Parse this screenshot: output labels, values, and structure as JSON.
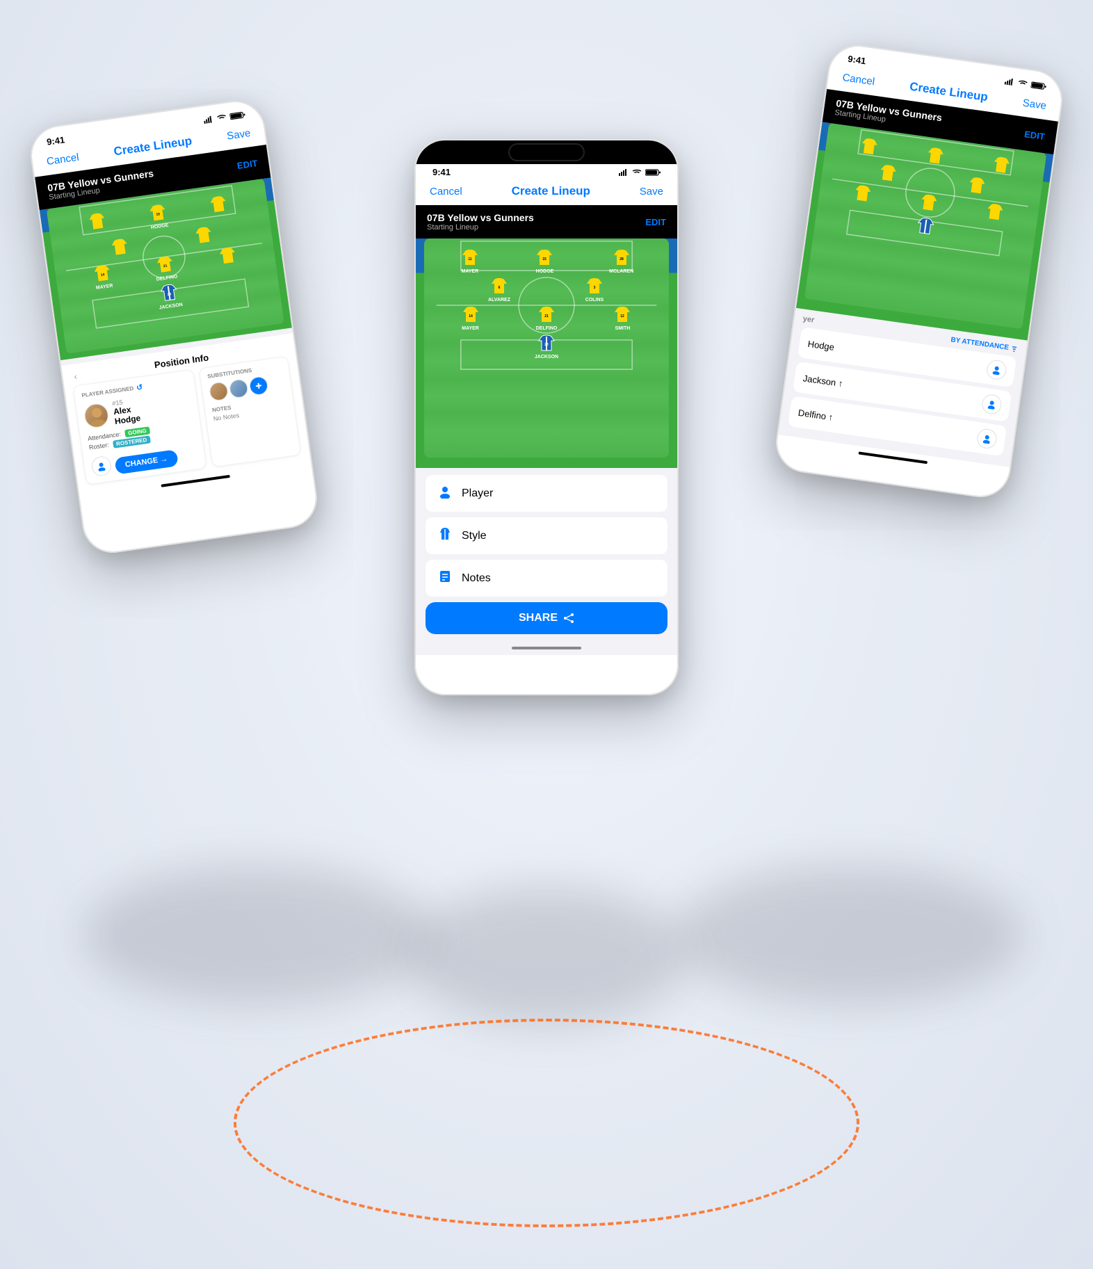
{
  "scene": {
    "bg_color": "#e8edf5"
  },
  "phone_left": {
    "status_time": "9:41",
    "nav": {
      "cancel": "Cancel",
      "title": "Create Lineup",
      "save": "Save"
    },
    "game": {
      "title": "07B Yellow vs Gunners",
      "subtitle": "Starting Lineup",
      "edit": "EDIT"
    },
    "position_info_title": "Position Info",
    "player_assigned_label": "PLAYER ASSIGNED",
    "player": {
      "number": "#15",
      "name": "Alex\nHodge",
      "attendance_label": "Attendance:",
      "attendance_value": "GOING",
      "roster_label": "Roster:",
      "roster_value": "ROSTERED"
    },
    "change_btn": "CHANGE →",
    "substitutions_label": "SUBSTITUTIONS",
    "notes_label": "NOTES",
    "notes_value": "No Notes",
    "jerseys": {
      "top_row": [
        "",
        ""
      ],
      "mid_row": [
        "",
        ""
      ],
      "bottom_row": [
        {
          "num": "14",
          "name": "MAYER"
        },
        {
          "num": "21",
          "name": "DELFINO"
        }
      ],
      "goalie": {
        "num": "23",
        "name": "JACKSON"
      },
      "hodge": {
        "num": "15",
        "name": "HODGE"
      }
    }
  },
  "phone_right": {
    "status_time": "9:41",
    "nav": {
      "cancel": "Cancel",
      "title": "Create Lineup",
      "save": "Save"
    },
    "game": {
      "title": "07B Yellow vs Gunners",
      "subtitle": "Starting Lineup",
      "edit": "EDIT"
    },
    "player_list": {
      "title": "yer",
      "filter": "BY ATTENDANCE",
      "items": [
        {
          "name": "Hodge",
          "arrow": "↑"
        },
        {
          "name": "Jackson ↑",
          "arrow": ""
        },
        {
          "name": "Delfino ↑",
          "arrow": ""
        }
      ]
    }
  },
  "phone_center": {
    "status_time": "9:41",
    "nav": {
      "cancel": "Cancel",
      "title": "Create Lineup",
      "save": "Save"
    },
    "game": {
      "title": "07B Yellow vs Gunners",
      "subtitle": "Starting Lineup",
      "edit": "EDIT"
    },
    "jerseys": {
      "top_row": [
        {
          "num": "11",
          "name": "MAYER"
        },
        {
          "num": "15",
          "name": "HODGE"
        },
        {
          "num": "28",
          "name": "MCLAREN"
        }
      ],
      "mid_row": [
        {
          "num": "6",
          "name": "ALVAREZ"
        },
        {
          "num": "3",
          "name": "COLINS"
        }
      ],
      "bot_row": [
        {
          "num": "14",
          "name": "MAYER"
        },
        {
          "num": "21",
          "name": "DELFINO"
        },
        {
          "num": "12",
          "name": "SMITH"
        }
      ],
      "goalie": {
        "num": "23",
        "name": "JACKSON"
      }
    },
    "sheet_items": [
      {
        "icon": "👤",
        "label": "Player"
      },
      {
        "icon": "👕",
        "label": "Style"
      },
      {
        "icon": "📋",
        "label": "Notes"
      }
    ],
    "share_btn": "SHARE"
  }
}
